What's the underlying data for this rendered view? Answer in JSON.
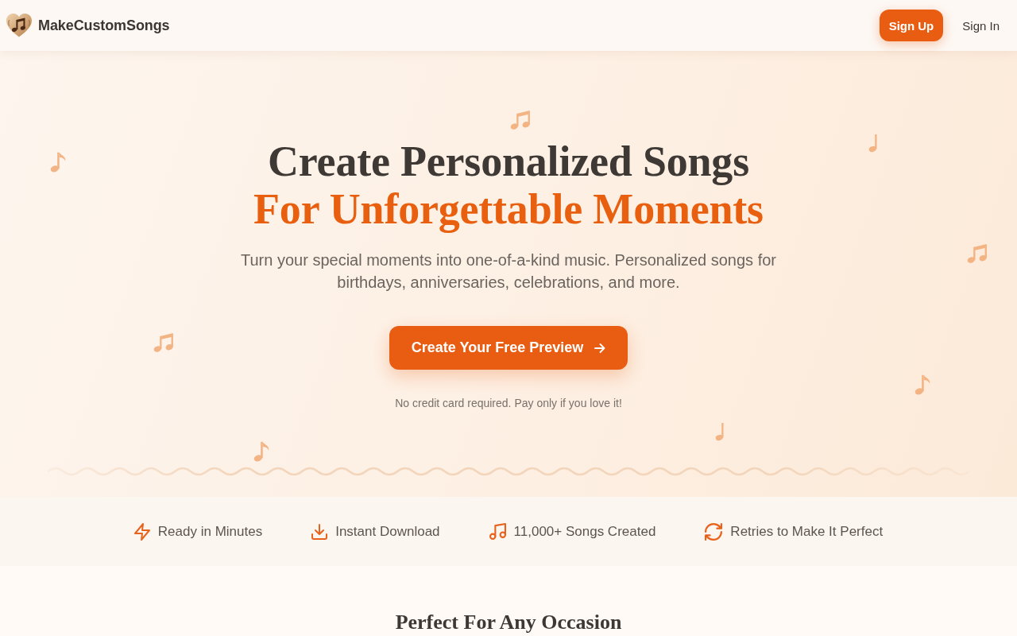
{
  "header": {
    "logo_text": "MakeCustomSongs",
    "buttons": [
      {
        "label": "Sign Up",
        "kind": "primary"
      },
      {
        "label": "Sign In",
        "kind": "link"
      }
    ]
  },
  "hero": {
    "title_lines": [
      {
        "text": "Create Personalized Songs",
        "highlight": false
      },
      {
        "text": "For Unforgettable Moments",
        "highlight": true
      }
    ],
    "subtitle": "Turn your special moments into one-of-a-kind music. Personalized songs for birthdays, anniversaries, celebrations, and more.",
    "cta": {
      "label": "Create Your Free Preview"
    },
    "note": "No credit card required. Pay only if you love it!"
  },
  "features": [
    {
      "label": "Ready in Minutes"
    },
    {
      "label": "Instant Download"
    },
    {
      "label": "11,000+ Songs Created"
    },
    {
      "label": "Retries to Make It Perfect"
    }
  ],
  "occasions": {
    "heading": "Perfect For Any Occasion"
  }
}
